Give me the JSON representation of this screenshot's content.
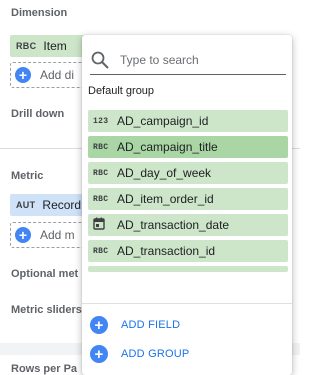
{
  "panel": {
    "dimension_title": "Dimension",
    "dimension_chip": {
      "type": "RBC",
      "label": "Item"
    },
    "add_dimension_label": "Add di",
    "drill_down_label": "Drill down",
    "metric_title": "Metric",
    "metric_chip": {
      "type": "AUT",
      "label": "Record"
    },
    "add_metric_label": "Add m",
    "optional_metrics_label": "Optional met",
    "metric_sliders_label": "Metric sliders",
    "rows_per_page_label": "Rows per Pa"
  },
  "popup": {
    "search_placeholder": "Type to search",
    "group_label": "Default group",
    "fields": [
      {
        "type": "123",
        "icon": "number-type-icon",
        "name": "AD_campaign_id",
        "selected": false
      },
      {
        "type": "RBC",
        "icon": "text-type-icon",
        "name": "AD_campaign_title",
        "selected": true
      },
      {
        "type": "RBC",
        "icon": "text-type-icon",
        "name": "AD_day_of_week",
        "selected": false
      },
      {
        "type": "RBC",
        "icon": "text-type-icon",
        "name": "AD_item_order_id",
        "selected": false
      },
      {
        "type": "",
        "icon": "calendar-icon",
        "name": "AD_transaction_date",
        "selected": false
      },
      {
        "type": "RBC",
        "icon": "text-type-icon",
        "name": "AD_transaction_id",
        "selected": false
      }
    ],
    "add_field_label": "ADD FIELD",
    "add_group_label": "ADD GROUP"
  },
  "colors": {
    "dimension_chip": "#cde6c9",
    "metric_chip": "#cfe2f7",
    "selected_field": "#a9d6a4",
    "accent_blue": "#1a73e8"
  }
}
